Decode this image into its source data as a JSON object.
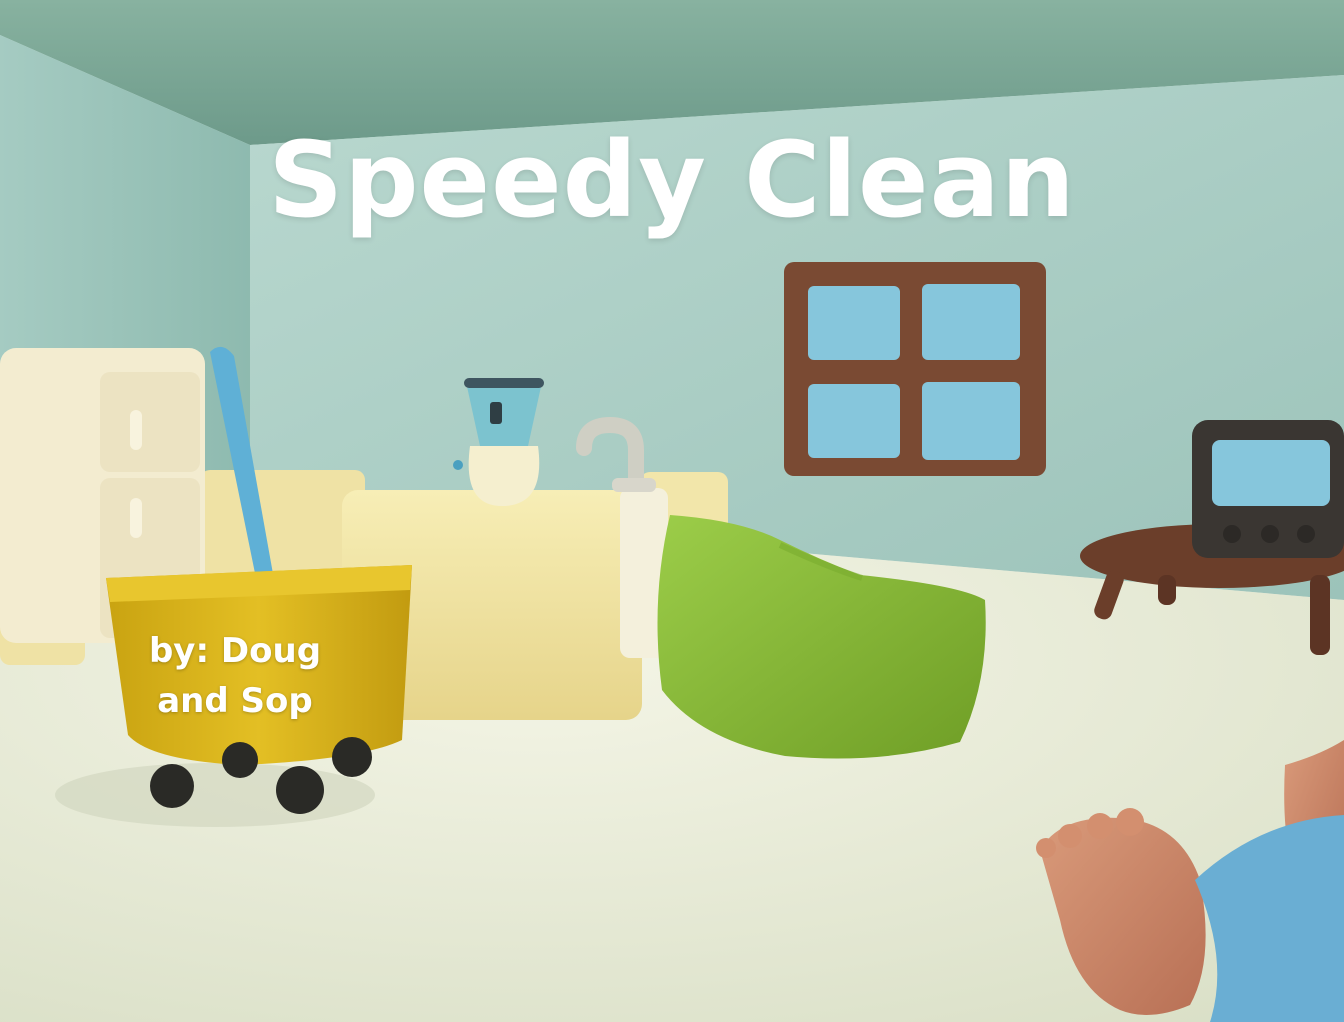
{
  "game": {
    "title": "Speedy Clean",
    "credits_line1": "by: Doug",
    "credits_line2": "and Sop"
  },
  "palette": {
    "wall_back": "#a9ccc2",
    "wall_left": "#8fbab0",
    "ceiling": "#7fa998",
    "floor": "#e4e8d4",
    "bucket": "#d9b51c",
    "mop_handle": "#5fb0d6",
    "beanbag": "#8fbf3a",
    "window_frame": "#7a4a33",
    "glass": "#86c6dc",
    "counter": "#f0e3a0"
  }
}
